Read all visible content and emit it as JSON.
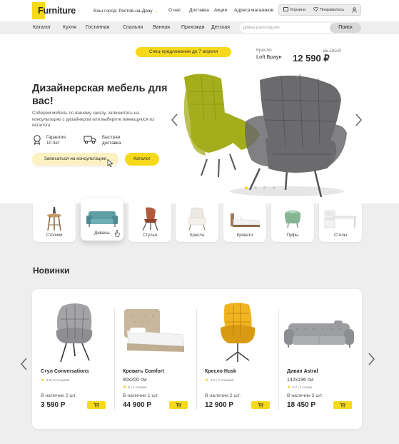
{
  "header": {
    "logo_letter": "F",
    "logo_text": "urniture",
    "city_label": "Ваш город:",
    "city_value": "Ростов-на-Дону",
    "nav": [
      "О нас",
      "Доставка",
      "Акции",
      "Адреса магазинов"
    ],
    "cart_label": "Корзина",
    "favorites_label": "Понравилось"
  },
  "catbar": {
    "items": [
      "Каталог",
      "Кухня",
      "Гостинная",
      "Спальня",
      "Ванная",
      "Прихожая",
      "Детская"
    ],
    "search_placeholder": "Диван раскладной",
    "search_button": "Поиск"
  },
  "hero": {
    "promo": "Спец-предложение до 7 апреля",
    "product_label": "Кресло",
    "product_name": "Loft Браун",
    "price": "12 590 ₽",
    "old_price": "15 790 ₽",
    "title": "Дизайнерская мебель для вас!",
    "description": "Соберем мебель по вашему заказу, запишитесь на консультацию с дизайнером или выберите имеющуюся из каталога.",
    "feature_1": "Гарантия\n10 лет",
    "feature_2": "Быстрая\nдоставка",
    "consult_button": "Записаться на консультацию",
    "catalog_button": "Каталог",
    "slides_total": 4,
    "slide_active": 1,
    "colors": {
      "accent": "#f7d91c",
      "chair_front": "#6b6a6c",
      "chair_back": "#a4ae1c"
    }
  },
  "categories": [
    {
      "label": "Столики",
      "icon": "table-icon"
    },
    {
      "label": "Диваны",
      "icon": "sofa-icon",
      "active": true
    },
    {
      "label": "Стулья",
      "icon": "chair-icon"
    },
    {
      "label": "Кресла",
      "icon": "armchair-icon"
    },
    {
      "label": "Кровати",
      "icon": "bed-icon"
    },
    {
      "label": "Пуфы",
      "icon": "pouf-icon"
    },
    {
      "label": "Столы",
      "icon": "desk-icon"
    }
  ],
  "new_section": {
    "title": "Новинки",
    "products": [
      {
        "name": "Стул Conversations",
        "size": "",
        "rating": "4.8",
        "reviews": "5 отзывов",
        "stock": "В наличии 2 шт.",
        "price": "3 590 Р"
      },
      {
        "name": "Кровать Comfort",
        "size": "90x200 см",
        "rating": "5",
        "reviews": "4 отзыва",
        "stock": "В наличии 1 шт.",
        "price": "44 900 Р"
      },
      {
        "name": "Кресло  Husk",
        "size": "",
        "rating": "4.2",
        "reviews": "7 отзывов",
        "stock": "В наличии 2 шт.",
        "price": "12 900 Р"
      },
      {
        "name": "Диван Astral",
        "size": "142x196 см",
        "rating": "4.7",
        "reviews": "1 отзыв",
        "stock": "В наличии 3 шт.",
        "price": "18 450 Р"
      }
    ]
  }
}
